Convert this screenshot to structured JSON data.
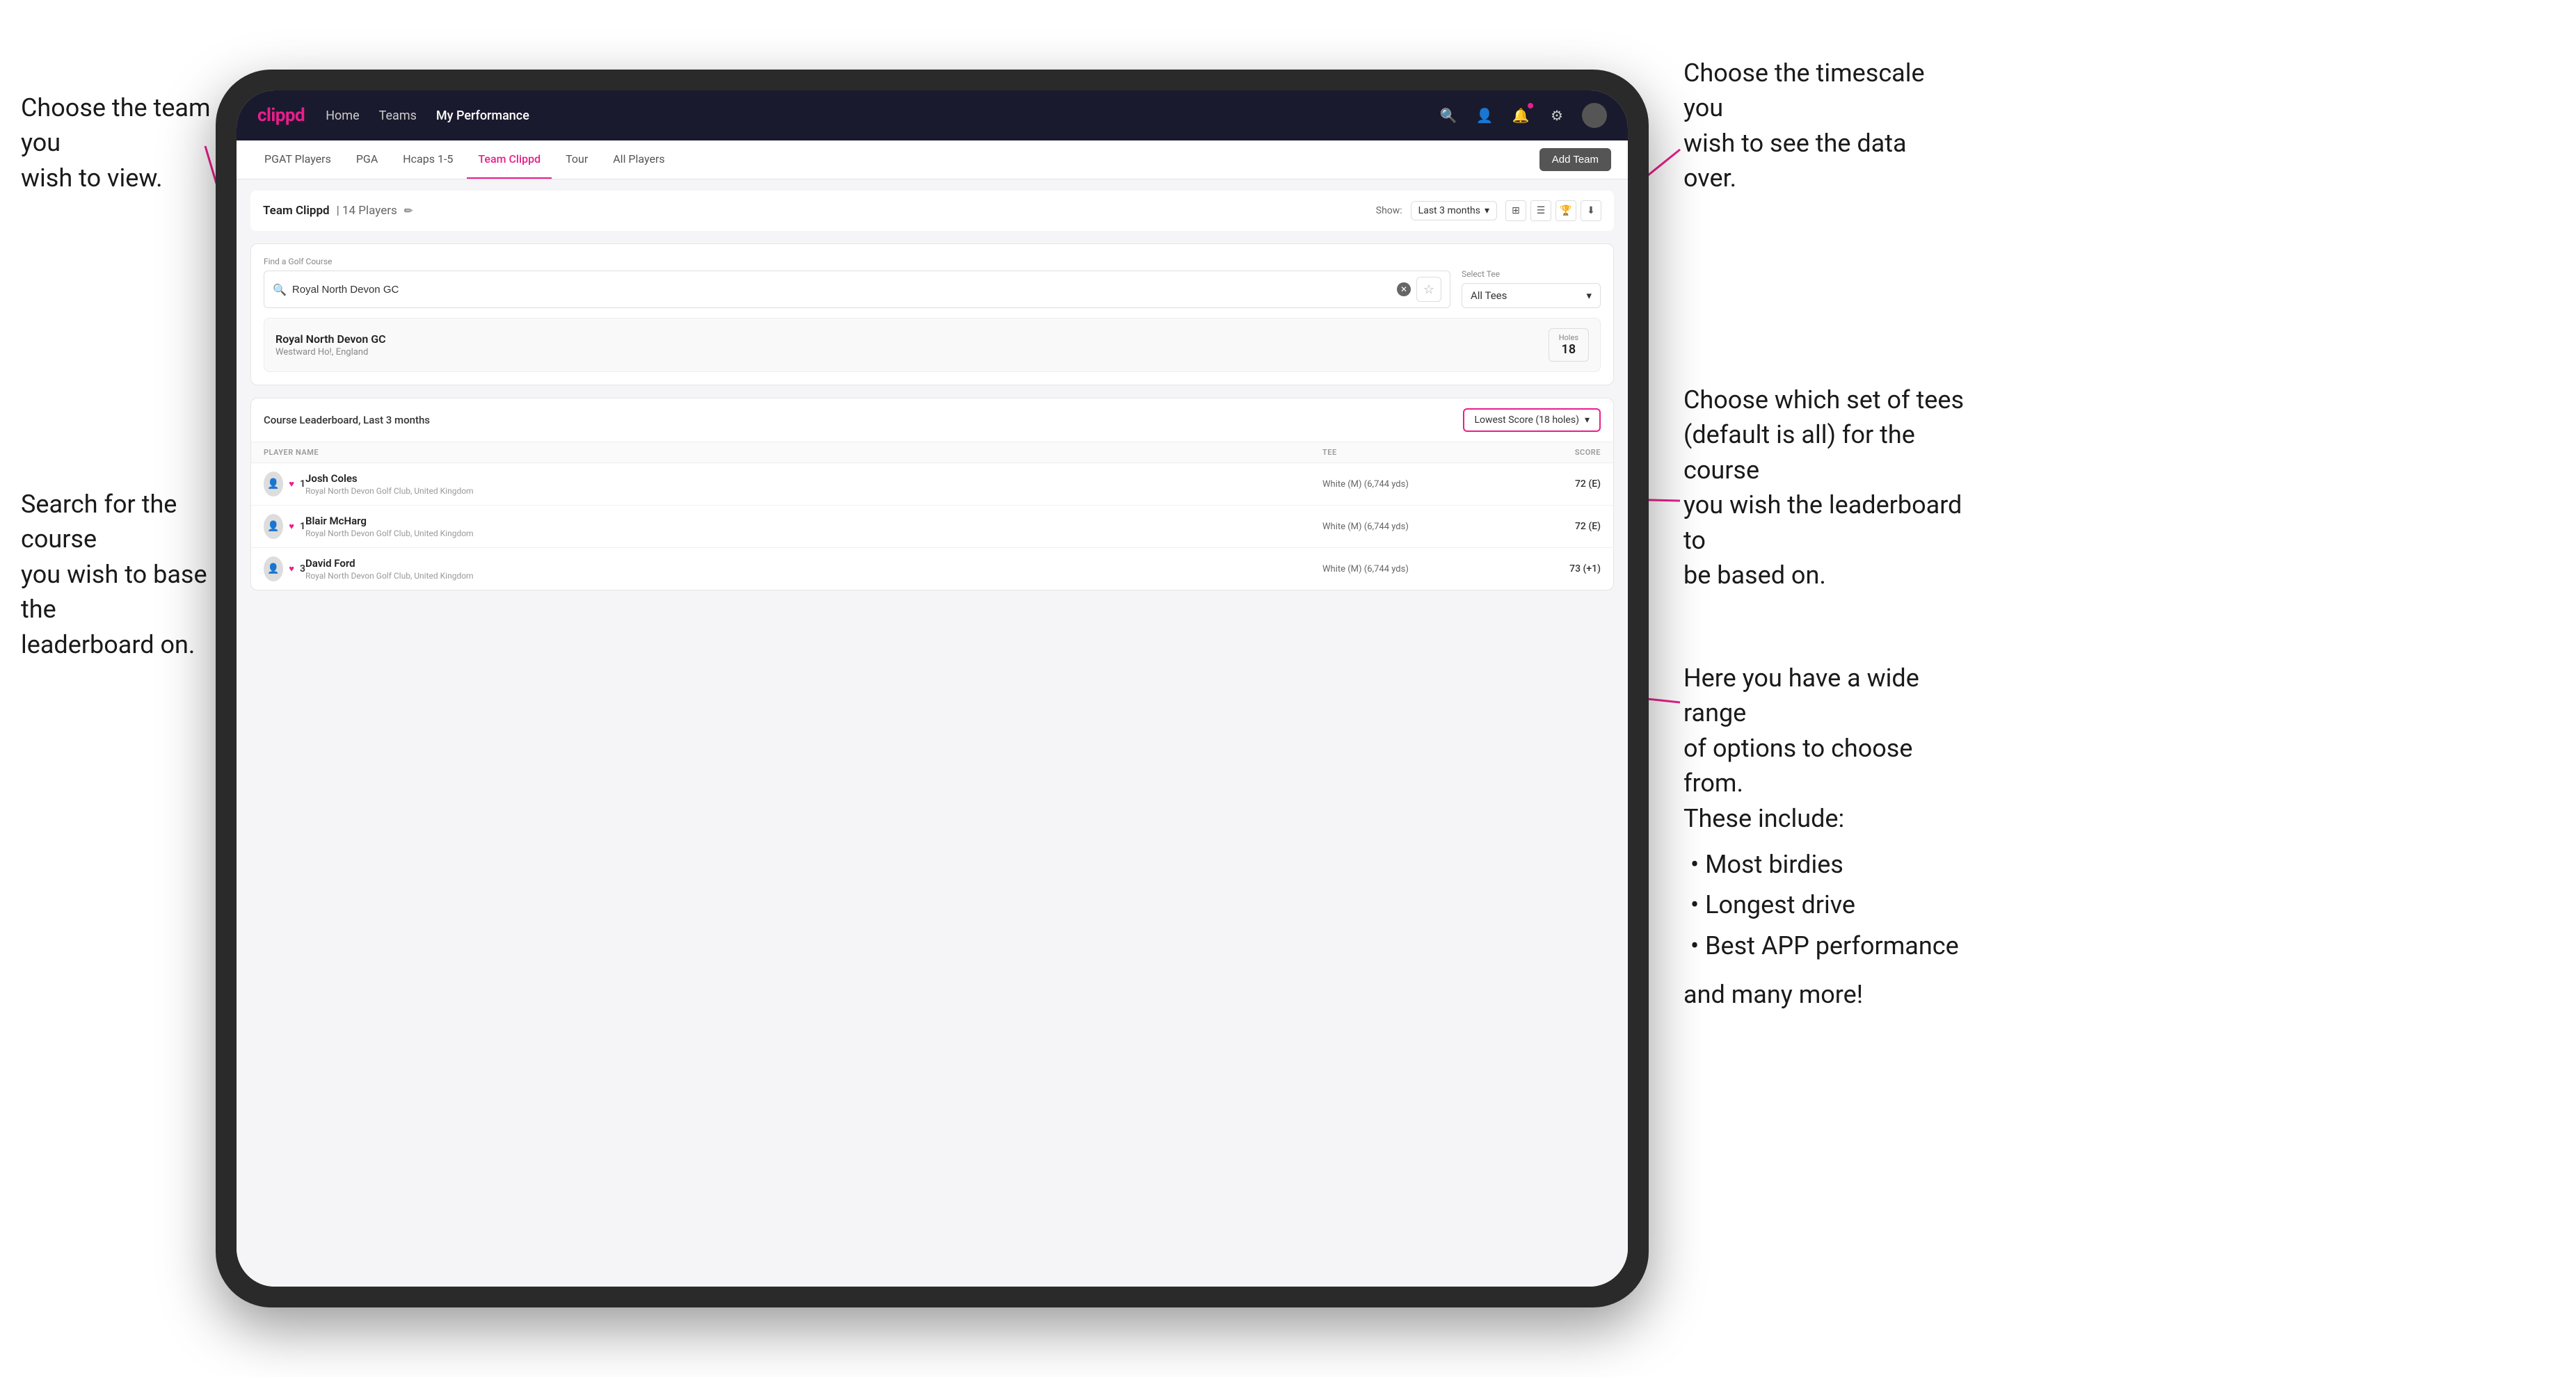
{
  "app": {
    "logo": "clippd",
    "nav_links": [
      "Home",
      "Teams",
      "My Performance"
    ],
    "nav_active": "My Performance"
  },
  "annotations": {
    "top_left": "Choose the team you\nwish to view.",
    "bottom_left": "Search for the course\nyou wish to base the\nleaderboard on.",
    "top_right": "Choose the timescale you\nwish to see the data over.",
    "middle_right": "Choose which set of tees\n(default is all) for the course\nyou wish the leaderboard to\nbe based on.",
    "bottom_right_title": "Here you have a wide range\nof options to choose from.\nThese include:",
    "bottom_right_list": [
      "Most birdies",
      "Longest drive",
      "Best APP performance"
    ],
    "bottom_right_footer": "and many more!"
  },
  "subnav": {
    "tabs": [
      "PGAT Players",
      "PGA",
      "Hcaps 1-5",
      "Team Clippd",
      "Tour",
      "All Players"
    ],
    "active_tab": "Team Clippd",
    "add_team_label": "Add Team"
  },
  "team_header": {
    "title": "Team Clippd",
    "player_count": "14 Players",
    "show_label": "Show:",
    "time_period": "Last 3 months"
  },
  "course_search": {
    "find_label": "Find a Golf Course",
    "search_placeholder": "Royal North Devon GC",
    "search_value": "Royal North Devon GC",
    "select_tee_label": "Select Tee",
    "tee_value": "All Tees"
  },
  "course_result": {
    "name": "Royal North Devon GC",
    "location": "Westward Ho!, England",
    "holes_label": "Holes",
    "holes_value": "18"
  },
  "leaderboard": {
    "title": "Course Leaderboard, Last 3 months",
    "score_type": "Lowest Score (18 holes)",
    "columns": [
      "PLAYER NAME",
      "TEE",
      "SCORE"
    ],
    "players": [
      {
        "rank": "1",
        "name": "Josh Coles",
        "club": "Royal North Devon Golf Club, United Kingdom",
        "tee": "White (M) (6,744 yds)",
        "score": "72 (E)"
      },
      {
        "rank": "1",
        "name": "Blair McHarg",
        "club": "Royal North Devon Golf Club, United Kingdom",
        "tee": "White (M) (6,744 yds)",
        "score": "72 (E)"
      },
      {
        "rank": "3",
        "name": "David Ford",
        "club": "Royal North Devon Golf Club, United Kingdom",
        "tee": "White (M) (6,744 yds)",
        "score": "73 (+1)"
      }
    ]
  }
}
